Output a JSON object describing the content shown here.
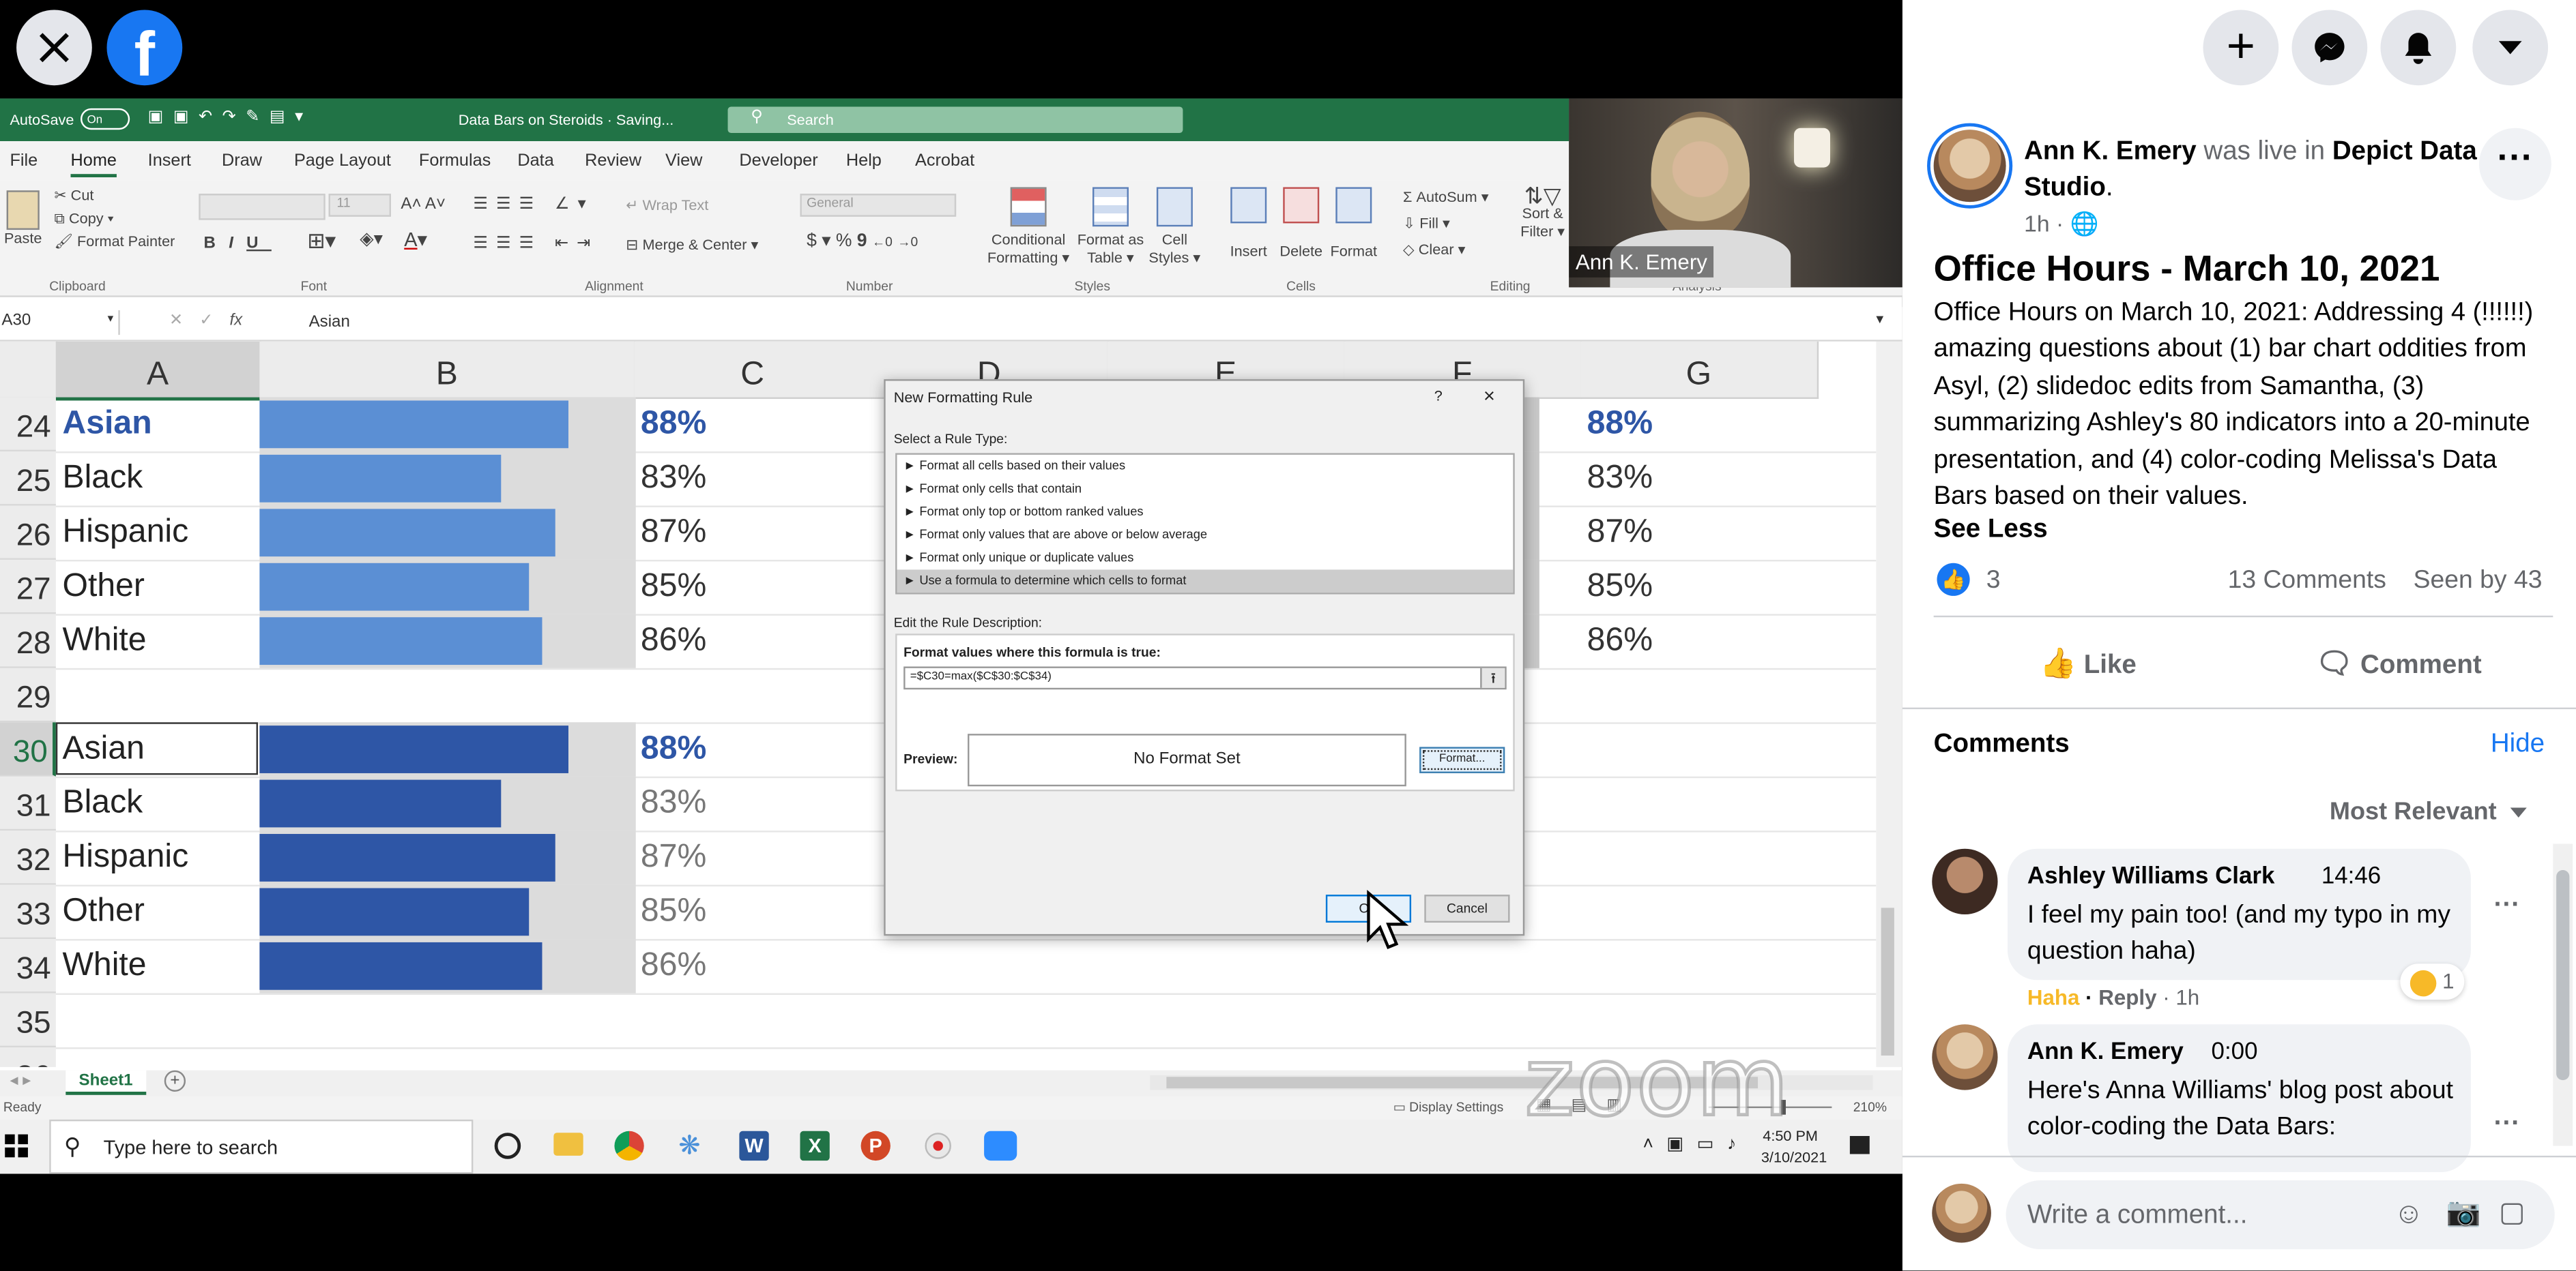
{
  "excel": {
    "autosave": "AutoSave",
    "autosave_state": "On",
    "doc_title": "Data Bars on Steroids · Saving...",
    "search": "Search",
    "menu": [
      "File",
      "Home",
      "Insert",
      "Draw",
      "Page Layout",
      "Formulas",
      "Data",
      "Review",
      "View",
      "Developer",
      "Help",
      "Acrobat"
    ],
    "ribbon": {
      "paste": "Paste",
      "cut": "Cut",
      "copy": "Copy",
      "format_painter": "Format Painter",
      "font_size": "11",
      "wrap_text": "Wrap Text",
      "merge_center": "Merge & Center",
      "number_format": "General",
      "dollar": "$",
      "percent": "%",
      "comma": "9",
      "dec_inc": "←0",
      "dec_dec": "→0",
      "conditional": "Conditional",
      "formatting": "Formatting",
      "format_as": "Format as",
      "table": "Table",
      "cell": "Cell",
      "styles": "Styles",
      "insert": "Insert",
      "delete": "Delete",
      "format": "Format",
      "autosum": "AutoSum",
      "fill": "Fill",
      "clear": "Clear",
      "sort": "Sort &",
      "filter": "Filter",
      "groups": [
        "Clipboard",
        "Font",
        "Alignment",
        "Number",
        "Styles",
        "Cells",
        "Editing",
        "Analysis"
      ]
    },
    "name_box": "A30",
    "formula_value": "Asian",
    "columns": [
      "A",
      "B",
      "C",
      "D",
      "E",
      "F",
      "G"
    ],
    "rows": [
      {
        "num": "24",
        "label": "Asian",
        "pct": "88%",
        "value": 0.88,
        "style": "header"
      },
      {
        "num": "25",
        "label": "Black",
        "pct": "83%",
        "value": 0.83,
        "style": "light"
      },
      {
        "num": "26",
        "label": "Hispanic",
        "pct": "87%",
        "value": 0.87,
        "style": "light"
      },
      {
        "num": "27",
        "label": "Other",
        "pct": "85%",
        "value": 0.85,
        "style": "light"
      },
      {
        "num": "28",
        "label": "White",
        "pct": "86%",
        "value": 0.86,
        "style": "light"
      },
      {
        "num": "29",
        "label": "",
        "pct": "",
        "value": 0,
        "style": "empty"
      },
      {
        "num": "30",
        "label": "Asian",
        "pct": "88%",
        "value": 0.88,
        "style": "darkhead"
      },
      {
        "num": "31",
        "label": "Black",
        "pct": "83%",
        "value": 0.83,
        "style": "dark"
      },
      {
        "num": "32",
        "label": "Hispanic",
        "pct": "87%",
        "value": 0.87,
        "style": "dark"
      },
      {
        "num": "33",
        "label": "Other",
        "pct": "85%",
        "value": 0.85,
        "style": "dark"
      },
      {
        "num": "34",
        "label": "White",
        "pct": "86%",
        "value": 0.86,
        "style": "dark"
      },
      {
        "num": "35",
        "label": "",
        "pct": "",
        "value": 0,
        "style": "empty"
      },
      {
        "num": "36",
        "label": "",
        "pct": "",
        "value": 0,
        "style": "empty"
      }
    ],
    "right_pcts": [
      "88%",
      "83%",
      "87%",
      "85%",
      "86%"
    ],
    "sheet_tab": "Sheet1",
    "status": "Ready",
    "display_settings": "Display Settings",
    "zoom": "210%",
    "colors": {
      "light_bar": "#5b8fd4",
      "dark_bar": "#2e56a6",
      "header_text": "#2e56a6",
      "excel_green": "#217346"
    }
  },
  "dialog": {
    "title": "New Formatting Rule",
    "help": "?",
    "close": "×",
    "select_rule_type": "Select a Rule Type:",
    "rule_types": [
      "► Format all cells based on their values",
      "► Format only cells that contain",
      "► Format only top or bottom ranked values",
      "► Format only values that are above or below average",
      "► Format only unique or duplicate values",
      "► Use a formula to determine which cells to format"
    ],
    "edit_rule": "Edit the Rule Description:",
    "formula_label": "Format values where this formula is true:",
    "formula": "=$C30=max($C$30:$C$34)",
    "preview_label": "Preview:",
    "preview_text": "No Format Set",
    "format_button": "Format...",
    "ok_button": "OK",
    "cancel_button": "Cancel"
  },
  "webcam": {
    "name": "Ann K. Emery"
  },
  "taskbar": {
    "search_placeholder": "Type here to search",
    "time": "4:50 PM",
    "date": "3/10/2021"
  },
  "watermark": "zoom",
  "facebook": {
    "author": "Ann K. Emery",
    "was_live_in": "was live in",
    "page": "Depict Data Studio",
    "time": "1h",
    "title": "Office Hours - March 10, 2021",
    "description": "Office Hours on March 10, 2021: Addressing 4 (!!!!!!) amazing questions about (1) bar chart oddities from Asyl, (2) slidedoc edits from Samantha, (3) summarizing Ashley's 80 indicators into a 20-minute presentation, and (4) color-coding Melissa's Data Bars based on their values.",
    "see_less": "See Less",
    "likes": "3",
    "comments_count": "13 Comments",
    "seen_by": "Seen by 43",
    "like_btn": "Like",
    "comment_btn": "Comment",
    "comments_header": "Comments",
    "hide": "Hide",
    "sort": "Most Relevant",
    "comments": [
      {
        "author": "Ashley Williams Clark",
        "stamp": "14:46",
        "text": "I feel my pain too! (and my typo in my question haha)",
        "reaction": "Haha",
        "reply": "Reply",
        "time": "1h",
        "react_count": "1"
      },
      {
        "author": "Ann K. Emery",
        "stamp": "0:00",
        "text": "Here's Anna Williams' blog post about color-coding the Data Bars:"
      }
    ],
    "write_placeholder": "Write a comment...",
    "brand_blue": "#1877f2"
  }
}
